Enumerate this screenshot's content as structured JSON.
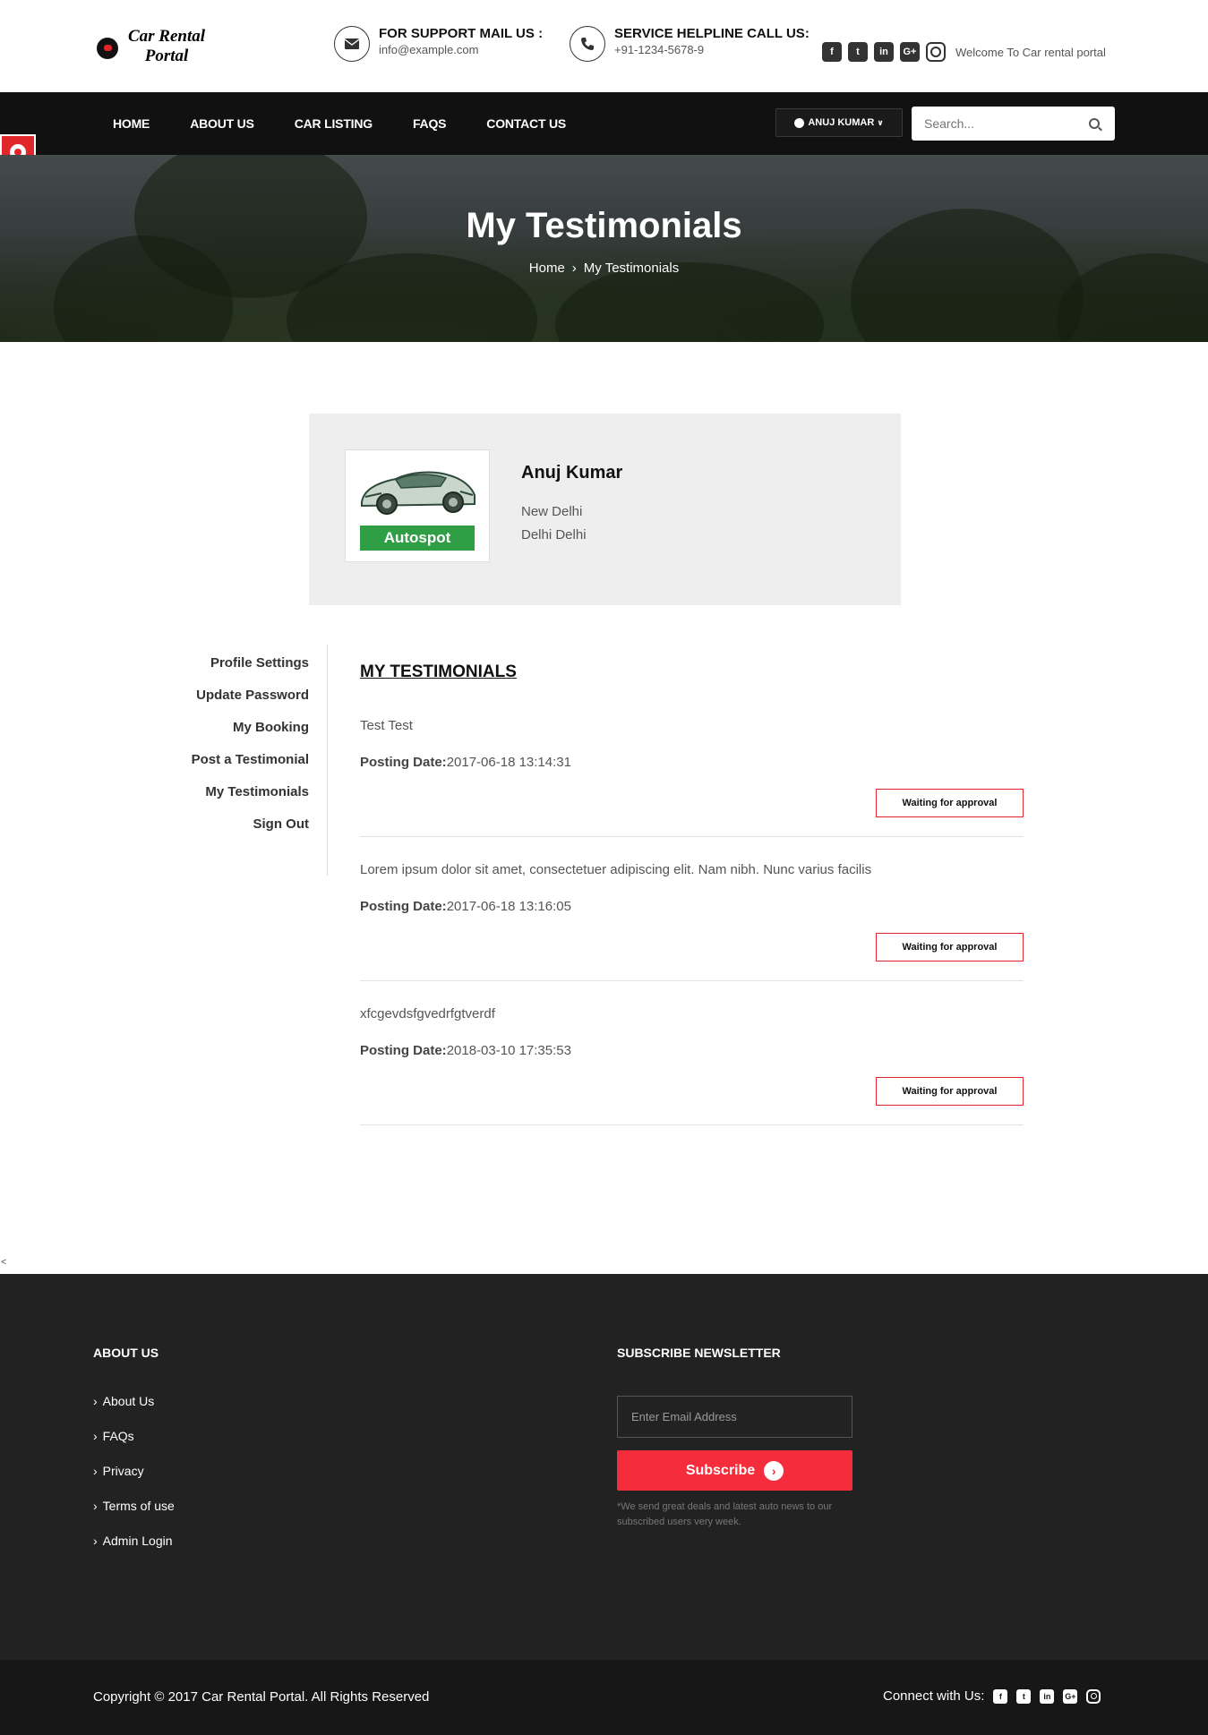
{
  "header": {
    "logo_line1": "Car Rental",
    "logo_line2": "Portal",
    "support_title": "FOR SUPPORT MAIL US :",
    "support_email": "info@example.com",
    "helpline_title": "SERVICE HELPLINE CALL US:",
    "helpline_phone": "+91-1234-5678-9",
    "social_icons": [
      "facebook-icon",
      "twitter-icon",
      "linkedin-icon",
      "google-plus-icon",
      "instagram-icon"
    ],
    "welcome": "Welcome To Car rental portal"
  },
  "nav": {
    "items": [
      "HOME",
      "ABOUT US",
      "CAR LISTING",
      "FAQS",
      "CONTACT US"
    ],
    "user_label": "ANUJ KUMAR",
    "search_placeholder": "Search..."
  },
  "banner": {
    "title": "My Testimonials",
    "breadcrumb_home": "Home",
    "breadcrumb_separator": "›",
    "breadcrumb_current": "My Testimonials"
  },
  "profile": {
    "image_label": "Autospot",
    "name": "Anuj Kumar",
    "line1": "New Delhi",
    "line2": "Delhi Delhi"
  },
  "sidebar": {
    "items": [
      "Profile Settings",
      "Update Password",
      "My Booking",
      "Post a Testimonial",
      "My Testimonials",
      "Sign Out"
    ]
  },
  "testimonials": {
    "title": "MY TESTIMONIALS",
    "date_label": "Posting Date:",
    "items": [
      {
        "text": "Test Test",
        "date": "2017-06-18 13:14:31",
        "status": "Waiting for approval"
      },
      {
        "text": "Lorem ipsum dolor sit amet, consectetuer adipiscing elit. Nam nibh. Nunc varius facilis",
        "date": "2017-06-18 13:16:05",
        "status": "Waiting for approval"
      },
      {
        "text": "xfcgevdsfgvedrfgtverdf",
        "date": "2018-03-10 17:35:53",
        "status": "Waiting for approval"
      }
    ]
  },
  "stray_mark": "<",
  "footer": {
    "about_heading": "ABOUT US",
    "links": [
      "About Us",
      "FAQs",
      "Privacy",
      "Terms of use",
      "Admin Login"
    ],
    "newsletter_heading": "SUBSCRIBE NEWSLETTER",
    "email_placeholder": "Enter Email Address",
    "subscribe_label": "Subscribe",
    "note": "*We send great deals and latest auto news to our subscribed users very week.",
    "copyright": "Copyright © 2017 Car Rental Portal. All Rights Reserved",
    "connect_label": "Connect with Us:"
  },
  "colors": {
    "accent_red": "#e0262b",
    "subscribe_red": "#f42c3b",
    "nav_bg": "#111111",
    "footer_bg": "#222223",
    "bottom_bar_bg": "#171717",
    "profile_card_bg": "#eeeeee"
  }
}
